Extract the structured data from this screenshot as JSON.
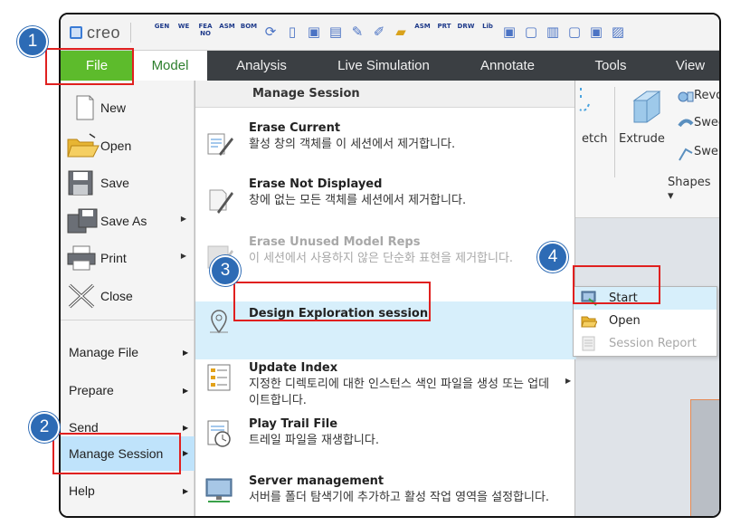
{
  "app": {
    "logo_text": "creo"
  },
  "toolbar_icons": [
    "GEN",
    "WE",
    "FEA NO",
    "ASM",
    "BOM",
    "ASM",
    "PRT",
    "DRW",
    "Lib"
  ],
  "menubar": {
    "tabs": [
      {
        "label": "File",
        "active": true
      },
      {
        "label": "Model"
      },
      {
        "label": "Analysis"
      },
      {
        "label": "Live Simulation"
      },
      {
        "label": "Annotate"
      },
      {
        "label": "Tools"
      },
      {
        "label": "View"
      }
    ]
  },
  "ribbon": {
    "sketch_partial": "etch",
    "extrude": "Extrude",
    "revolve_partial": "Revo",
    "sweep_partial": "Swee",
    "swept_blend_partial": "Swep",
    "shapes": "Shapes ▾"
  },
  "file_menu": {
    "new": "New",
    "open": "Open",
    "save": "Save",
    "save_as": "Save As",
    "print": "Print",
    "close": "Close",
    "manage_file": "Manage File",
    "prepare": "Prepare",
    "send": "Send",
    "manage_session": "Manage Session",
    "help": "Help",
    "arrow": "▶"
  },
  "submenu": {
    "header": "Manage Session",
    "items": [
      {
        "title": "Erase Current",
        "desc": "활성 창의 객체를 이 세션에서 제거합니다."
      },
      {
        "title": "Erase Not Displayed",
        "desc": "창에 없는 모든 객체를 세션에서 제거합니다."
      },
      {
        "title": "Erase Unused Model Reps",
        "desc": "이 세션에서 사용하지 않은 단순화 표현을 제거합니다."
      },
      {
        "title": "Design Exploration session",
        "desc": ""
      },
      {
        "title": "Update Index",
        "desc": "지정한 디렉토리에 대한 인스턴스 색인 파일을 생성 또는 업데이트합니다."
      },
      {
        "title": "Play Trail File",
        "desc": "트레일 파일을 재생합니다."
      },
      {
        "title": "Server management",
        "desc": "서버를 폴더 탐색기에 추가하고 활성 작업 영역을 설정합니다."
      }
    ],
    "arrow": "▶"
  },
  "popup": {
    "start": "Start",
    "open": "Open",
    "session_report": "Session Report"
  },
  "annotations": {
    "b1": "1",
    "b2": "2",
    "b3": "3",
    "b4": "4"
  },
  "colors": {
    "file_tab": "#5dbb2c",
    "menubar": "#3b3f43",
    "highlight": "#bfe3fb",
    "badge": "#2d6bb5",
    "callout": "#e0201f"
  }
}
